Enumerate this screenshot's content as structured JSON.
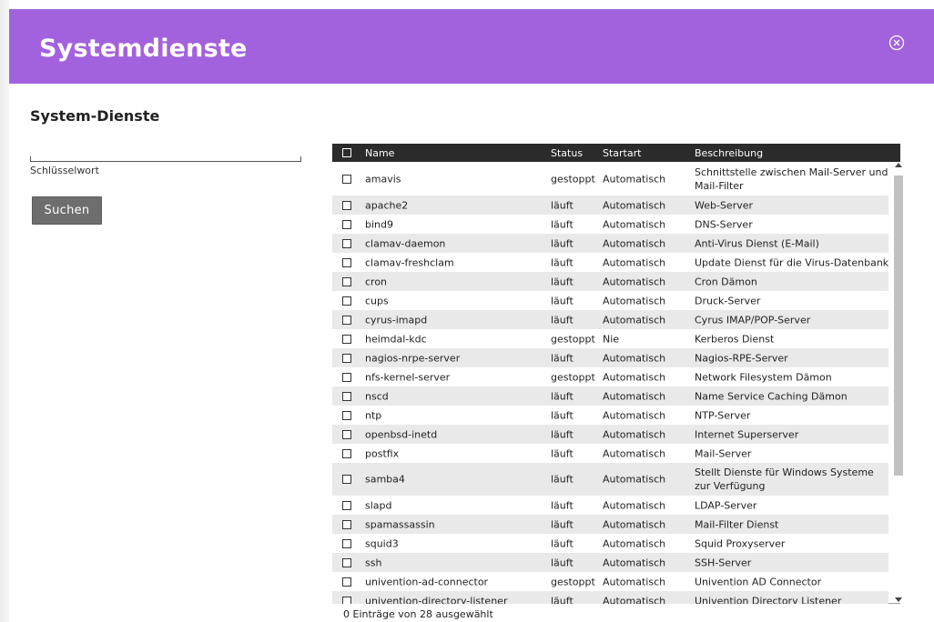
{
  "dialog": {
    "title": "Systemdienste",
    "accent_color": "#a362dd",
    "close_icon": "close-circle-icon"
  },
  "sidebar": {
    "section_title": "System-Dienste",
    "search": {
      "value": "",
      "placeholder": "",
      "label": "Schlüsselwort"
    },
    "search_button": "Suchen"
  },
  "grid": {
    "columns": [
      "Name",
      "Status",
      "Startart",
      "Beschreibung"
    ],
    "rows": [
      {
        "name": "amavis",
        "status": "gestoppt",
        "startart": "Automatisch",
        "beschreibung": "Schnittstelle zwischen Mail-Server und Mail-Filter"
      },
      {
        "name": "apache2",
        "status": "läuft",
        "startart": "Automatisch",
        "beschreibung": "Web-Server"
      },
      {
        "name": "bind9",
        "status": "läuft",
        "startart": "Automatisch",
        "beschreibung": "DNS-Server"
      },
      {
        "name": "clamav-daemon",
        "status": "läuft",
        "startart": "Automatisch",
        "beschreibung": "Anti-Virus Dienst (E-Mail)"
      },
      {
        "name": "clamav-freshclam",
        "status": "läuft",
        "startart": "Automatisch",
        "beschreibung": "Update Dienst für die Virus-Datenbank"
      },
      {
        "name": "cron",
        "status": "läuft",
        "startart": "Automatisch",
        "beschreibung": "Cron Dämon"
      },
      {
        "name": "cups",
        "status": "läuft",
        "startart": "Automatisch",
        "beschreibung": "Druck-Server"
      },
      {
        "name": "cyrus-imapd",
        "status": "läuft",
        "startart": "Automatisch",
        "beschreibung": "Cyrus IMAP/POP-Server"
      },
      {
        "name": "heimdal-kdc",
        "status": "gestoppt",
        "startart": "Nie",
        "beschreibung": "Kerberos Dienst"
      },
      {
        "name": "nagios-nrpe-server",
        "status": "läuft",
        "startart": "Automatisch",
        "beschreibung": "Nagios-RPE-Server"
      },
      {
        "name": "nfs-kernel-server",
        "status": "gestoppt",
        "startart": "Automatisch",
        "beschreibung": "Network Filesystem Dämon"
      },
      {
        "name": "nscd",
        "status": "läuft",
        "startart": "Automatisch",
        "beschreibung": "Name Service Caching Dämon"
      },
      {
        "name": "ntp",
        "status": "läuft",
        "startart": "Automatisch",
        "beschreibung": "NTP-Server"
      },
      {
        "name": "openbsd-inetd",
        "status": "läuft",
        "startart": "Automatisch",
        "beschreibung": "Internet Superserver"
      },
      {
        "name": "postfix",
        "status": "läuft",
        "startart": "Automatisch",
        "beschreibung": "Mail-Server"
      },
      {
        "name": "samba4",
        "status": "läuft",
        "startart": "Automatisch",
        "beschreibung": "Stellt Dienste für Windows Systeme zur Verfügung"
      },
      {
        "name": "slapd",
        "status": "läuft",
        "startart": "Automatisch",
        "beschreibung": "LDAP-Server"
      },
      {
        "name": "spamassassin",
        "status": "läuft",
        "startart": "Automatisch",
        "beschreibung": "Mail-Filter Dienst"
      },
      {
        "name": "squid3",
        "status": "läuft",
        "startart": "Automatisch",
        "beschreibung": "Squid Proxyserver"
      },
      {
        "name": "ssh",
        "status": "läuft",
        "startart": "Automatisch",
        "beschreibung": "SSH-Server"
      },
      {
        "name": "univention-ad-connector",
        "status": "gestoppt",
        "startart": "Automatisch",
        "beschreibung": "Univention AD Connector"
      },
      {
        "name": "univention-directory-listener",
        "status": "läuft",
        "startart": "Automatisch",
        "beschreibung": "Univention Directory Listener"
      }
    ],
    "footer": "0 Einträge von 28 ausgewählt"
  }
}
